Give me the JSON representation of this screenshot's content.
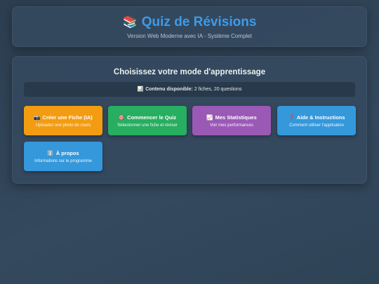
{
  "header": {
    "title_icon": "📚",
    "title": "Quiz de Révisions",
    "subtitle": "Version Web Moderne avec IA - Système Complet"
  },
  "main": {
    "heading": "Choisissez votre mode d'apprentissage",
    "content_info": {
      "icon": "📊",
      "label": "Contenu disponible:",
      "value": "2 fiches, 20 questions"
    },
    "buttons": [
      {
        "icon": "📷",
        "title": "Créer une Fiche (IA)",
        "desc": "Uploadez une photo de cours",
        "color": "#f39c12"
      },
      {
        "icon": "🎯",
        "title": "Commencer le Quiz",
        "desc": "Sélectionner une fiche et réviser",
        "color": "#27ae60"
      },
      {
        "icon": "📈",
        "title": "Mes Statistiques",
        "desc": "Voir mes performances",
        "color": "#9b59b6"
      },
      {
        "icon": "❓",
        "title": "Aide & Instructions",
        "desc": "Comment utiliser l'application",
        "color": "#3498db"
      },
      {
        "icon": "ℹ️",
        "title": "À propos",
        "desc": "Informations sur le programme",
        "color": "#3498db"
      }
    ]
  }
}
